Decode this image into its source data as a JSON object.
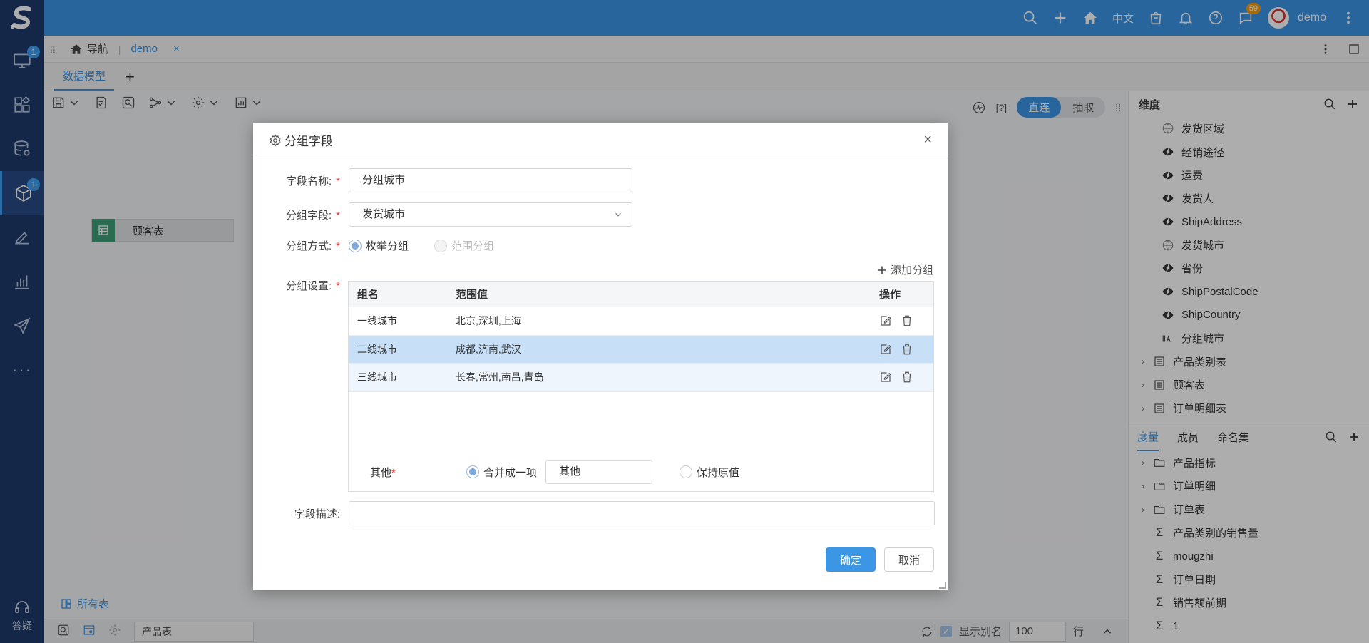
{
  "topbar": {
    "lang": "中文",
    "message_badge": "59",
    "username": "demo"
  },
  "leftnav": {
    "badges": [
      "1",
      "1"
    ],
    "help_label": "答疑"
  },
  "navbar": {
    "home_label": "导航",
    "tab_label": "demo",
    "tab_close": "×"
  },
  "subtabs": {
    "active": "数据模型",
    "add": "+"
  },
  "canvas": {
    "mode_help": "[?]",
    "mode_direct": "直连",
    "mode_extract": "抽取",
    "table_node": "顾客表",
    "all_tables": "所有表"
  },
  "statusbar": {
    "table_name": "产品表",
    "show_alias": "显示别名",
    "rows": "100",
    "rows_unit": "行"
  },
  "rightpanel": {
    "dim_title": "维度",
    "dims": [
      {
        "label": "发货区域",
        "icon": "globe-icon"
      },
      {
        "label": "经销途径",
        "icon": "field-icon"
      },
      {
        "label": "运费",
        "icon": "field-icon"
      },
      {
        "label": "发货人",
        "icon": "field-icon"
      },
      {
        "label": "ShipAddress",
        "icon": "field-icon"
      },
      {
        "label": "发货城市",
        "icon": "globe-icon"
      },
      {
        "label": "省份",
        "icon": "field-icon"
      },
      {
        "label": "ShipPostalCode",
        "icon": "field-icon"
      },
      {
        "label": "ShipCountry",
        "icon": "field-icon"
      },
      {
        "label": "分组城市",
        "icon": "group-field-icon"
      }
    ],
    "tables": [
      "产品类别表",
      "顾客表",
      "订单明细表"
    ],
    "tabs": [
      "度量",
      "成员",
      "命名集"
    ],
    "folders": [
      "产品指标",
      "订单明细",
      "订单表"
    ],
    "measures": [
      "产品类别的销售量",
      "mougzhi",
      "订单日期",
      "销售额前期",
      "1"
    ]
  },
  "dialog": {
    "title": "分组字段",
    "close": "×",
    "field_name_label": "字段名称:",
    "field_name_value": "分组城市",
    "group_field_label": "分组字段:",
    "group_field_value": "发货城市",
    "group_mode_label": "分组方式:",
    "mode_enum": "枚举分组",
    "mode_range": "范围分组",
    "group_setting_label": "分组设置:",
    "add_group": "添加分组",
    "table_headers": [
      "组名",
      "范围值",
      "操作"
    ],
    "rows": [
      {
        "name": "一线城市",
        "values": "北京,深圳,上海"
      },
      {
        "name": "二线城市",
        "values": "成都,济南,武汉"
      },
      {
        "name": "三线城市",
        "values": "长春,常州,南昌,青岛"
      }
    ],
    "other_label": "其他",
    "merge_label": "合并成一项",
    "other_value": "其他",
    "keep_label": "保持原值",
    "desc_label": "字段描述:",
    "desc_value": "",
    "ok": "确定",
    "cancel": "取消",
    "required_mark": "*"
  }
}
